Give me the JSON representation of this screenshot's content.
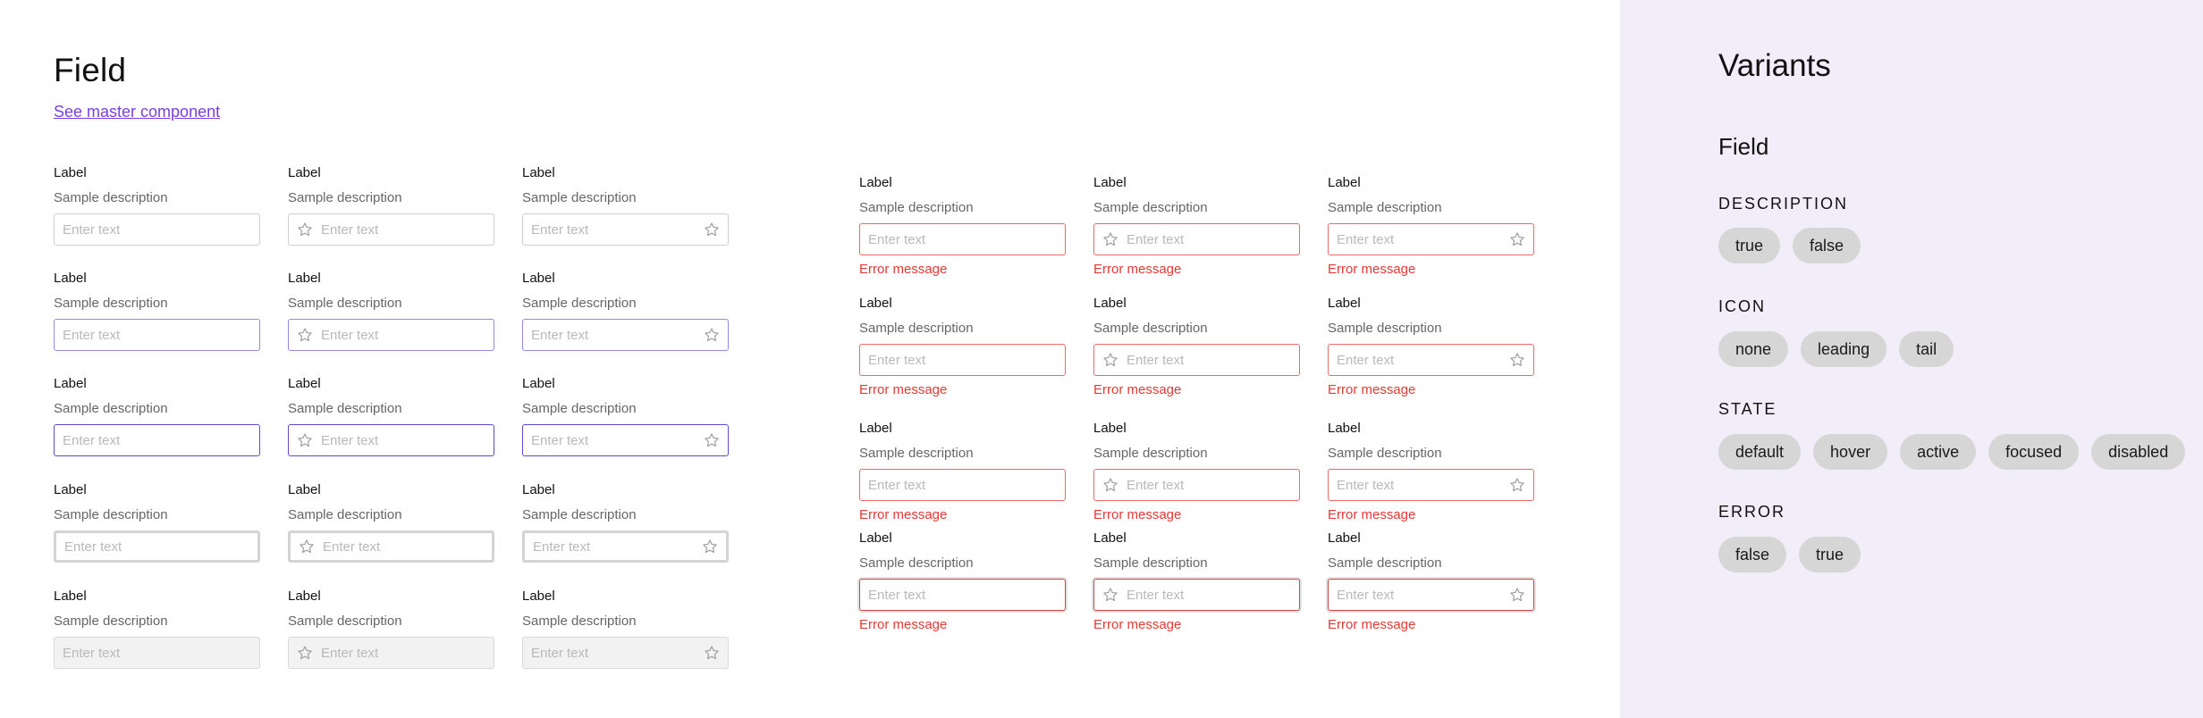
{
  "page": {
    "title": "Field",
    "master_link": "See master component"
  },
  "field": {
    "label": "Label",
    "description": "Sample description",
    "placeholder": "Enter text",
    "error_message": "Error message",
    "icon": "star-icon"
  },
  "left_grid": {
    "columns": [
      "none",
      "leading",
      "tail"
    ],
    "rows": [
      "default",
      "hover",
      "active",
      "focused",
      "disabled"
    ]
  },
  "right_grid": {
    "columns": [
      "none",
      "leading",
      "tail"
    ],
    "rows": [
      "default",
      "hover",
      "active",
      "focused"
    ],
    "error": true
  },
  "variants": {
    "title": "Variants",
    "subtitle": "Field",
    "groups": [
      {
        "title": "DESCRIPTION",
        "options": [
          "true",
          "false"
        ]
      },
      {
        "title": "ICON",
        "options": [
          "none",
          "leading",
          "tail"
        ]
      },
      {
        "title": "STATE",
        "options": [
          "default",
          "hover",
          "active",
          "focused",
          "disabled"
        ]
      },
      {
        "title": "ERROR",
        "options": [
          "false",
          "true"
        ]
      }
    ]
  },
  "colors": {
    "link": "#7a3fe0",
    "hover_border": "#9a86ea",
    "active_border": "#6247d6",
    "error": "#e53935",
    "panel_bg": "#f1eef9",
    "chip_bg": "#d6d6d6"
  }
}
